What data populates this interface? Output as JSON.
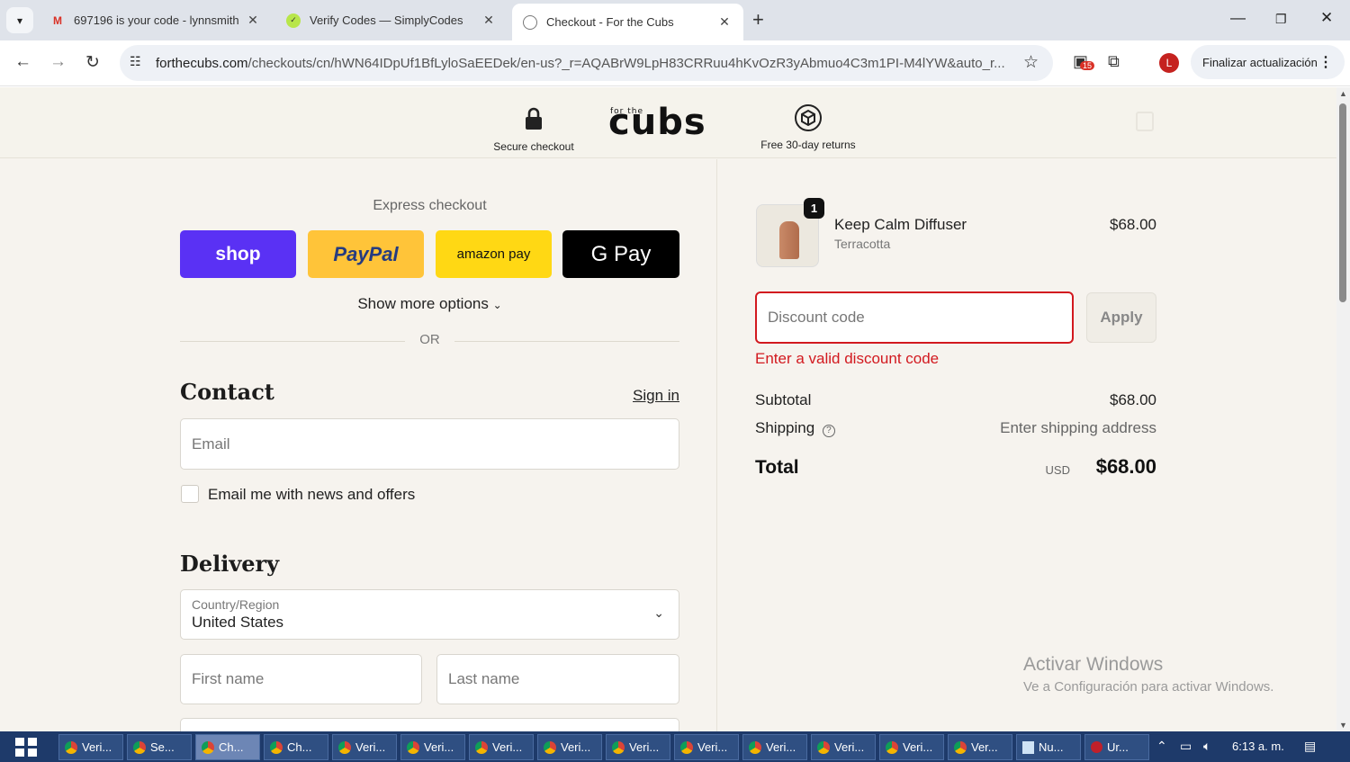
{
  "browser": {
    "tabs": [
      {
        "title": "697196 is your code - lynnsmith",
        "icon": "gmail-icon",
        "active": false
      },
      {
        "title": "Verify Codes — SimplyCodes",
        "icon": "simplycodes-icon",
        "active": false
      },
      {
        "title": "Checkout - For the Cubs",
        "icon": "globe-icon",
        "active": true
      }
    ],
    "url_host": "forthecubs.com",
    "url_path": "/checkouts/cn/hWN64IDpUf1BfLyloSaEEDek/en-us?_r=AQABrW9LpH83CRRuu4hKvOzR3yAbmuo4C3m1PI-M4lYW&auto_r...",
    "extensions_badge": "15",
    "profile_initial": "L",
    "update_label": "Finalizar actualización"
  },
  "header": {
    "secure_label": "Secure checkout",
    "logo_text": "cubs",
    "logo_small": "for the",
    "returns_label": "Free 30-day returns"
  },
  "express": {
    "title": "Express checkout",
    "buttons": [
      "shop",
      "PayPal",
      "amazon pay",
      "G Pay"
    ],
    "show_more": "Show more options",
    "or": "OR"
  },
  "contact": {
    "title": "Contact",
    "sign_in": "Sign in",
    "email_placeholder": "Email",
    "news_label": "Email me with news and offers"
  },
  "delivery": {
    "title": "Delivery",
    "country_label": "Country/Region",
    "country_value": "United States",
    "first_name": "First name",
    "last_name": "Last name"
  },
  "summary": {
    "product_name": "Keep Calm Diffuser",
    "product_variant": "Terracotta",
    "product_price": "$68.00",
    "quantity": "1",
    "discount_placeholder": "Discount code",
    "apply": "Apply",
    "error": "Enter a valid discount code",
    "subtotal_label": "Subtotal",
    "subtotal_value": "$68.00",
    "shipping_label": "Shipping",
    "shipping_value": "Enter shipping address",
    "total_label": "Total",
    "currency": "USD",
    "total_value": "$68.00"
  },
  "watermark": {
    "line1": "Activar Windows",
    "line2": "Ve a Configuración para activar Windows."
  },
  "taskbar": {
    "items": [
      "Veri...",
      "Se...",
      "Ch...",
      "Ch...",
      "Veri...",
      "Veri...",
      "Veri...",
      "Veri...",
      "Veri...",
      "Veri...",
      "Veri...",
      "Veri...",
      "Veri...",
      "Ver...",
      "Nu...",
      "Ur..."
    ],
    "clock": "6:13 a. m."
  },
  "colors": {
    "shop": "#5a31f4",
    "paypal": "#ffc439",
    "amazon": "#ffd814",
    "gpay": "#000000",
    "error": "#d2191f"
  }
}
